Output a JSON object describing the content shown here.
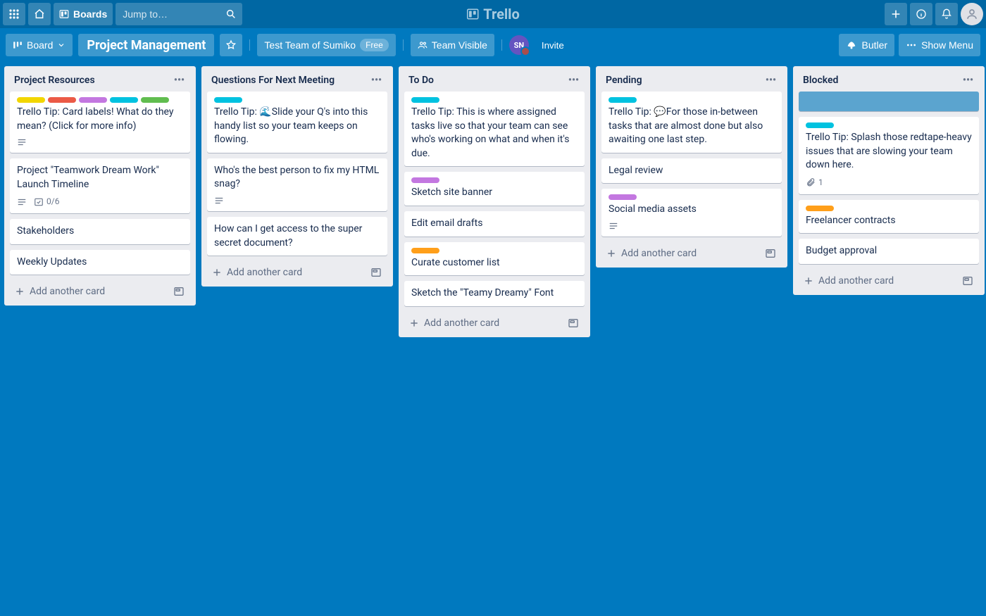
{
  "header": {
    "boards_btn": "Boards",
    "search_placeholder": "Jump to…",
    "logo": "Trello"
  },
  "board_header": {
    "view_switch": "Board",
    "title": "Project Management",
    "team": "Test Team of Sumiko",
    "free_label": "Free",
    "visibility": "Team Visible",
    "member_initials": "SN",
    "invite": "Invite",
    "butler": "Butler",
    "show_menu": "Show Menu"
  },
  "labels": {
    "yellow": "#f2d600",
    "red": "#eb5a46",
    "purple": "#c377e0",
    "sky": "#00c2e0",
    "green": "#61bd4f",
    "orange": "#ff9f1a"
  },
  "add_card_text": "Add another card",
  "lists": [
    {
      "title": "Project Resources",
      "cards": [
        {
          "labels": [
            "yellow",
            "red",
            "purple",
            "sky",
            "green"
          ],
          "text": "Trello Tip: Card labels! What do they mean? (Click for more info)",
          "desc": true
        },
        {
          "text": "Project \"Teamwork Dream Work\" Launch Timeline",
          "desc": true,
          "checklist": "0/6"
        },
        {
          "text": "Stakeholders"
        },
        {
          "text": "Weekly Updates"
        }
      ]
    },
    {
      "title": "Questions For Next Meeting",
      "cards": [
        {
          "labels": [
            "sky"
          ],
          "text": "Trello Tip: 🌊Slide your Q's into this handy list so your team keeps on flowing."
        },
        {
          "text": "Who's the best person to fix my HTML snag?",
          "desc": true
        },
        {
          "text": "How can I get access to the super secret document?"
        }
      ]
    },
    {
      "title": "To Do",
      "cards": [
        {
          "labels": [
            "sky"
          ],
          "text": "Trello Tip: This is where assigned tasks live so that your team can see who's working on what and when it's due."
        },
        {
          "labels": [
            "purple"
          ],
          "text": "Sketch site banner"
        },
        {
          "text": "Edit email drafts"
        },
        {
          "labels": [
            "orange"
          ],
          "text": "Curate customer list"
        },
        {
          "text": "Sketch the \"Teamy Dreamy\" Font"
        }
      ]
    },
    {
      "title": "Pending",
      "cards": [
        {
          "labels": [
            "sky"
          ],
          "text": "Trello Tip: 💬For those in-between tasks that are almost done but also awaiting one last step."
        },
        {
          "text": "Legal review"
        },
        {
          "labels": [
            "purple"
          ],
          "text": "Social media assets",
          "desc": true
        }
      ]
    },
    {
      "title": "Blocked",
      "cards": [
        {
          "selected": true
        },
        {
          "labels": [
            "sky"
          ],
          "text": "Trello Tip: Splash those redtape-heavy issues that are slowing your team down here.",
          "attachments": "1"
        },
        {
          "labels": [
            "orange"
          ],
          "text": "Freelancer contracts"
        },
        {
          "text": "Budget approval"
        }
      ]
    }
  ]
}
